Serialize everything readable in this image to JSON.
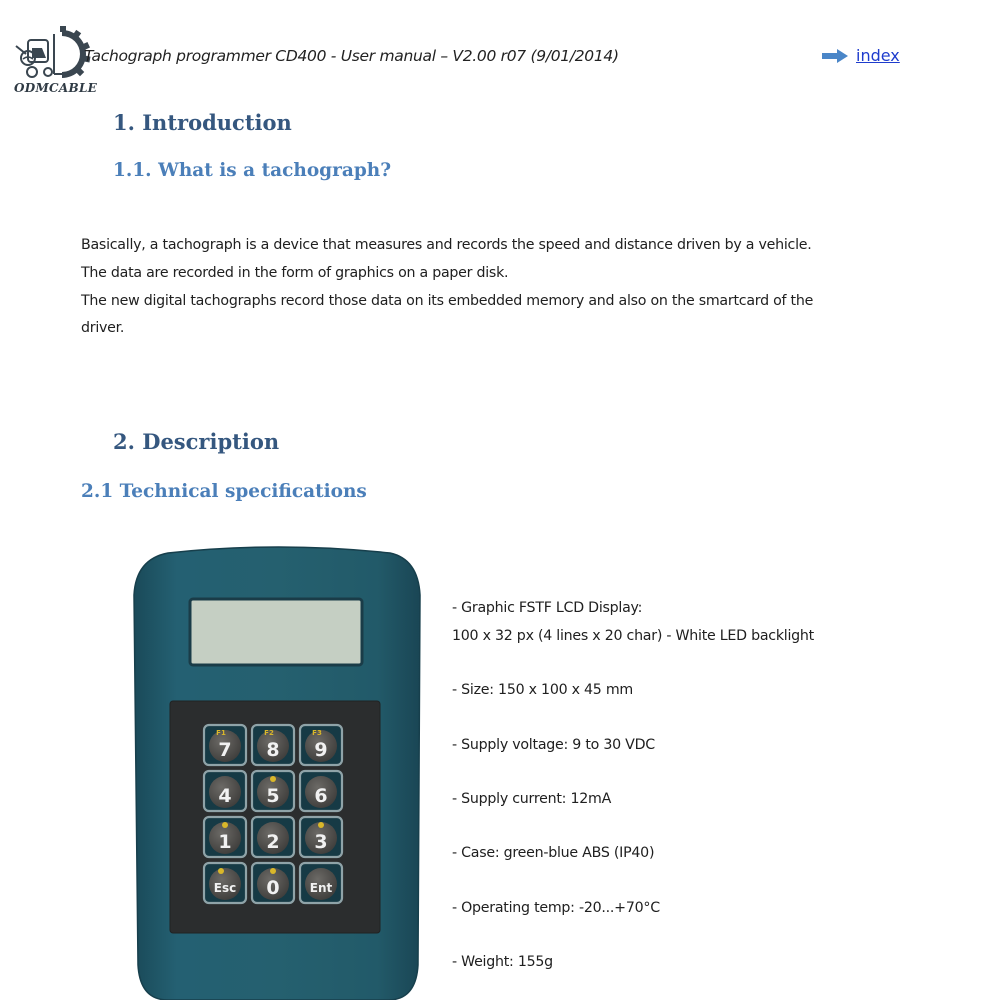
{
  "header": {
    "logo_text": "ODMCABLE",
    "title": "Tachograph programmer CD400 - User manual – V2.00 r07 (9/01/2014)",
    "index_link": "index"
  },
  "sections": {
    "intro_heading": "1.  Introduction",
    "intro_sub": "1.1. What is a tachograph?",
    "intro_paragraph": [
      "Basically, a tachograph is a device that measures and records the speed and distance driven by a vehicle.",
      "The data are recorded in the form of graphics on a paper disk.",
      "The new digital tachographs record those data on its embedded memory and also on the smartcard of the",
      "driver."
    ],
    "desc_heading": "2.  Description",
    "desc_sub": "2.1 Technical specifications"
  },
  "device": {
    "keys": [
      {
        "label": "7",
        "sub": "F1"
      },
      {
        "label": "8",
        "sub": "F2"
      },
      {
        "label": "9",
        "sub": "F3"
      },
      {
        "label": "4",
        "sub": ""
      },
      {
        "label": "5",
        "sub": "up-arrow"
      },
      {
        "label": "6",
        "sub": ""
      },
      {
        "label": "1",
        "sub": "left-arrow"
      },
      {
        "label": "2",
        "sub": ""
      },
      {
        "label": "3",
        "sub": "right-arrow"
      },
      {
        "label": "Esc",
        "sub": "I/O"
      },
      {
        "label": "0",
        "sub": "down-arrow"
      },
      {
        "label": "Ent",
        "sub": ""
      }
    ],
    "colors": {
      "case": "#1f5464",
      "lcd": "#c5cfc3",
      "keypad": "#2b2d2e",
      "key_label_sub": "#d9b72a"
    }
  },
  "specs": [
    "- Graphic FSTF LCD Display:",
    "100 x 32 px (4 lines x 20 char) - White LED backlight",
    "- Size: 150 x 100 x 45 mm",
    "- Supply voltage: 9 to 30 VDC",
    "- Supply current: 12mA",
    "- Case: green-blue ABS (IP40)",
    "- Operating temp: -20...+70°C",
    "- Weight: 155g"
  ]
}
